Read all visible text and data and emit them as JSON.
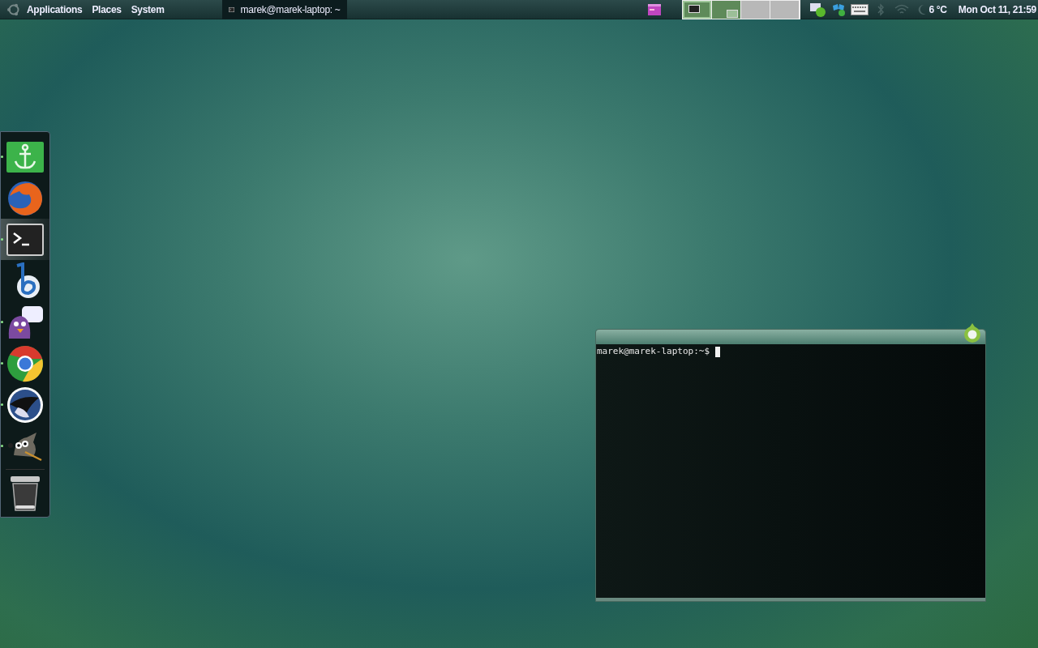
{
  "top_panel": {
    "menus": [
      {
        "label": "Applications"
      },
      {
        "label": "Places"
      },
      {
        "label": "System"
      }
    ],
    "taskbar": [
      {
        "label": "marek@marek-laptop: ~",
        "selected": true
      }
    ],
    "workspaces": [
      {
        "selected": true,
        "occupied": true
      },
      {
        "selected": false,
        "occupied": true
      },
      {
        "selected": false,
        "occupied": false
      },
      {
        "selected": false,
        "occupied": false
      }
    ],
    "temperature": "6 °C",
    "clock": "Mon Oct 11, 21:59"
  },
  "dock": {
    "items": [
      {
        "kind": "anchor",
        "running": true,
        "selected": false
      },
      {
        "kind": "firefox",
        "running": false,
        "selected": false
      },
      {
        "kind": "terminal",
        "running": true,
        "selected": true
      },
      {
        "kind": "blue-b",
        "running": false,
        "selected": false
      },
      {
        "kind": "pidgin",
        "running": true,
        "selected": false
      },
      {
        "kind": "chrome",
        "running": true,
        "selected": false
      },
      {
        "kind": "penguin",
        "running": true,
        "selected": false
      },
      {
        "kind": "gimp",
        "running": true,
        "selected": false
      },
      {
        "kind": "trash",
        "running": false,
        "selected": false
      }
    ]
  },
  "terminal": {
    "prompt": "marek@marek-laptop:~$"
  }
}
